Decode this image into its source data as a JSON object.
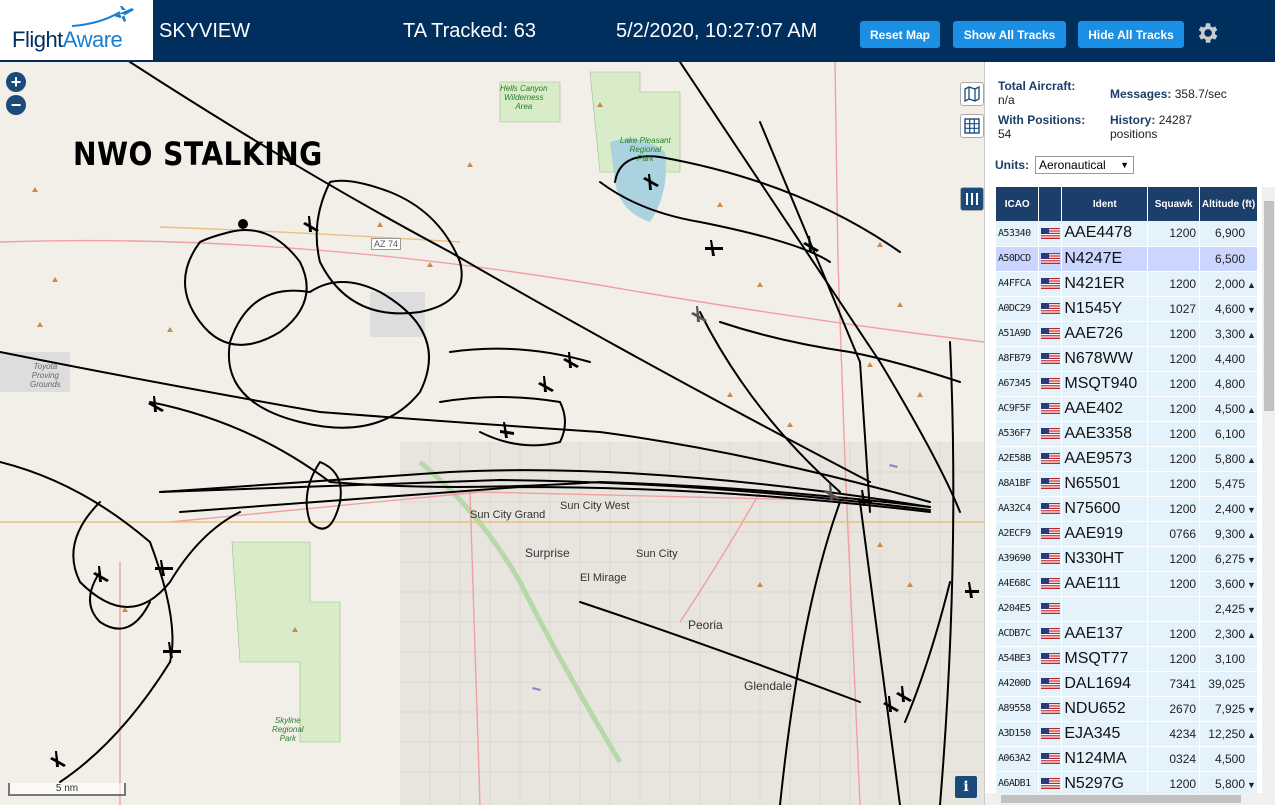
{
  "header": {
    "logo_text_a": "Flight",
    "logo_text_b": "Aware",
    "app_title": "SKYVIEW",
    "ta_tracked": "TA Tracked: 63",
    "clock": "5/2/2020, 10:27:07 AM",
    "buttons": {
      "reset": "Reset Map",
      "show_all": "Show All Tracks",
      "hide_all": "Hide All Tracks"
    }
  },
  "map": {
    "zoom_in": "+",
    "zoom_out": "−",
    "overlay_text": "NWO STALKING",
    "scale": "5 nm",
    "info": "i",
    "places": {
      "sun_city_grand": "Sun City Grand",
      "sun_city_west": "Sun City West",
      "surprise": "Surprise",
      "sun_city": "Sun City",
      "el_mirage": "El Mirage",
      "peoria": "Peoria",
      "glendale": "Glendale",
      "az74": "AZ 74"
    },
    "parks": {
      "hells_canyon": "Hells Canyon\nWilderness\nArea",
      "lake_pleasant": "Lake Pleasant\nRegional\nPark",
      "skyline": "Skyline\nRegional\nPark",
      "toyota": "Toyota\nProving\nGrounds"
    }
  },
  "panel": {
    "total_aircraft_label": "Total Aircraft:",
    "total_aircraft_value": "n/a",
    "with_positions_label": "With Positions:",
    "with_positions_value": "54",
    "messages_label": "Messages:",
    "messages_value": "358.7/sec",
    "history_label": "History:",
    "history_value": "24287",
    "history_unit": "positions",
    "units_label": "Units:",
    "units_value": "Aeronautical",
    "columns": {
      "icao": "ICAO",
      "ident": "Ident",
      "squawk": "Squawk",
      "altitude": "Altitude (ft)"
    },
    "rows": [
      {
        "icao": "A53340",
        "ident": "AAE4478",
        "squawk": "1200",
        "alt": "6,900",
        "trend": ""
      },
      {
        "icao": "A50DCD",
        "ident": "N4247E",
        "squawk": "",
        "alt": "6,500",
        "trend": ""
      },
      {
        "icao": "A4FFCA",
        "ident": "N421ER",
        "squawk": "1200",
        "alt": "2,000",
        "trend": "▲"
      },
      {
        "icao": "A0DC29",
        "ident": "N1545Y",
        "squawk": "1027",
        "alt": "4,600",
        "trend": "▼"
      },
      {
        "icao": "A51A9D",
        "ident": "AAE726",
        "squawk": "1200",
        "alt": "3,300",
        "trend": "▲"
      },
      {
        "icao": "A8FB79",
        "ident": "N678WW",
        "squawk": "1200",
        "alt": "4,400",
        "trend": ""
      },
      {
        "icao": "A67345",
        "ident": "MSQT940",
        "squawk": "1200",
        "alt": "4,800",
        "trend": ""
      },
      {
        "icao": "AC9F5F",
        "ident": "AAE402",
        "squawk": "1200",
        "alt": "4,500",
        "trend": "▲"
      },
      {
        "icao": "A536F7",
        "ident": "AAE3358",
        "squawk": "1200",
        "alt": "6,100",
        "trend": ""
      },
      {
        "icao": "A2E58B",
        "ident": "AAE9573",
        "squawk": "1200",
        "alt": "5,800",
        "trend": "▲"
      },
      {
        "icao": "A8A1BF",
        "ident": "N65501",
        "squawk": "1200",
        "alt": "5,475",
        "trend": ""
      },
      {
        "icao": "AA32C4",
        "ident": "N75600",
        "squawk": "1200",
        "alt": "2,400",
        "trend": "▼"
      },
      {
        "icao": "A2ECF9",
        "ident": "AAE919",
        "squawk": "0766",
        "alt": "9,300",
        "trend": "▲"
      },
      {
        "icao": "A39690",
        "ident": "N330HT",
        "squawk": "1200",
        "alt": "6,275",
        "trend": "▼"
      },
      {
        "icao": "A4E68C",
        "ident": "AAE111",
        "squawk": "1200",
        "alt": "3,600",
        "trend": "▼"
      },
      {
        "icao": "A204E5",
        "ident": "",
        "squawk": "",
        "alt": "2,425",
        "trend": "▼"
      },
      {
        "icao": "ACDB7C",
        "ident": "AAE137",
        "squawk": "1200",
        "alt": "2,300",
        "trend": "▲"
      },
      {
        "icao": "A54BE3",
        "ident": "MSQT77",
        "squawk": "1200",
        "alt": "3,100",
        "trend": ""
      },
      {
        "icao": "A4200D",
        "ident": "DAL1694",
        "squawk": "7341",
        "alt": "39,025",
        "trend": ""
      },
      {
        "icao": "A89558",
        "ident": "NDU652",
        "squawk": "2670",
        "alt": "7,925",
        "trend": "▼"
      },
      {
        "icao": "A3D150",
        "ident": "EJA345",
        "squawk": "4234",
        "alt": "12,250",
        "trend": "▲"
      },
      {
        "icao": "A063A2",
        "ident": "N124MA",
        "squawk": "0324",
        "alt": "4,500",
        "trend": ""
      },
      {
        "icao": "A6ADB1",
        "ident": "N5297G",
        "squawk": "1200",
        "alt": "5,800",
        "trend": "▼"
      }
    ]
  },
  "colors": {
    "header_bg": "#002f5d",
    "button_bg": "#1a8fe3",
    "table_header_bg": "#1b3e6a",
    "row_bg": "#e3f2fb",
    "row_selected_bg": "#cad6ff"
  }
}
